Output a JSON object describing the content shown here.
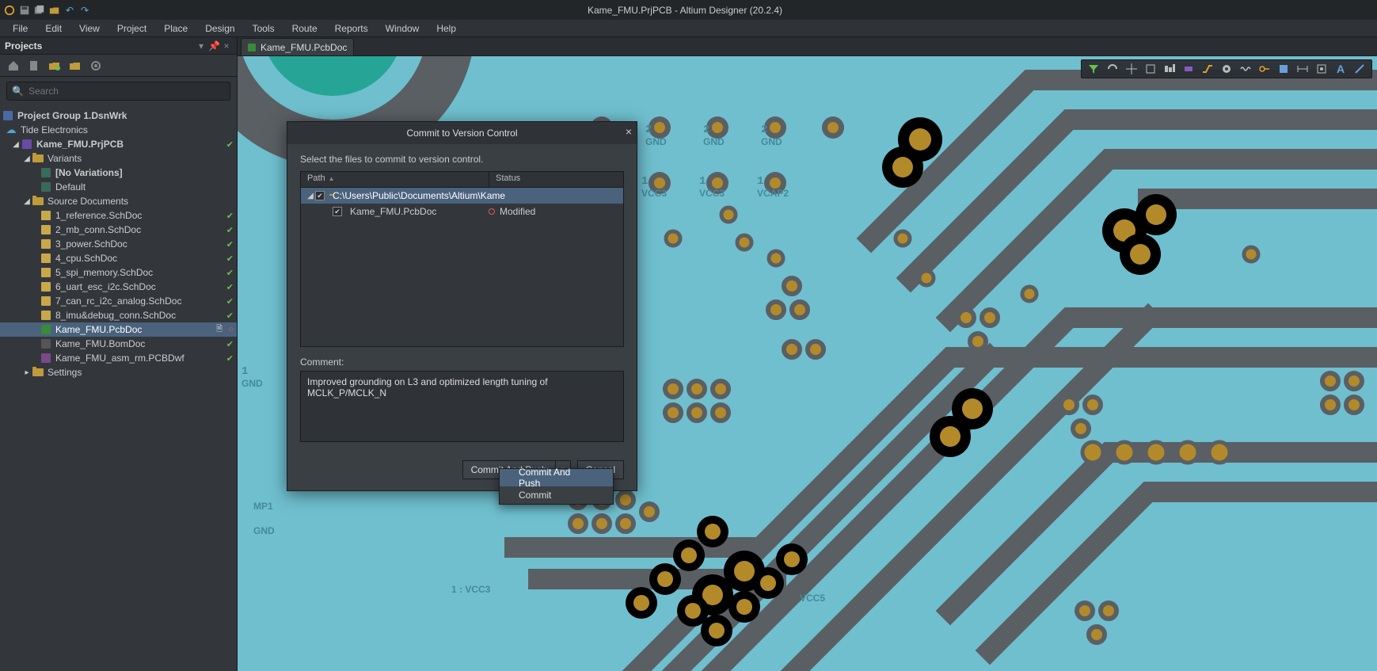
{
  "title": "Kame_FMU.PrjPCB - Altium Designer (20.2.4)",
  "menu": [
    "File",
    "Edit",
    "View",
    "Project",
    "Place",
    "Design",
    "Tools",
    "Route",
    "Reports",
    "Window",
    "Help"
  ],
  "panel": {
    "title": "Projects"
  },
  "search": {
    "placeholder": "Search"
  },
  "tree": {
    "group": "Project Group 1.DsnWrk",
    "workspace": "Tide Electronics",
    "project": "Kame_FMU.PrjPCB",
    "variants": "Variants",
    "novars": "[No Variations]",
    "default": "Default",
    "srcdocs": "Source Documents",
    "docs": [
      "1_reference.SchDoc",
      "2_mb_conn.SchDoc",
      "3_power.SchDoc",
      "4_cpu.SchDoc",
      "5_spi_memory.SchDoc",
      "6_uart_esc_i2c.SchDoc",
      "7_can_rc_i2c_analog.SchDoc",
      "8_imu&debug_conn.SchDoc",
      "Kame_FMU.PcbDoc",
      "Kame_FMU.BomDoc",
      "Kame_FMU_asm_rm.PCBDwf"
    ],
    "settings": "Settings"
  },
  "tab": {
    "name": "Kame_FMU.PcbDoc"
  },
  "dialog": {
    "title": "Commit to Version Control",
    "instr": "Select the files to commit to version control.",
    "hdr_path": "Path",
    "hdr_status": "Status",
    "folder": "C:\\Users\\Public\\Documents\\Altium\\Kame",
    "file": "Kame_FMU.PcbDoc",
    "file_status": "Modified",
    "comment_label": "Comment:",
    "comment": "Improved grounding on L3 and optimized length tuning of MCLK_P/MCLK_N",
    "btn_commit_push": "Commit And Push",
    "btn_cancel": "Cancel"
  },
  "dropdown": {
    "push": "Commit And Push",
    "commit": "Commit"
  },
  "pcblabels": {
    "gnd": "GND",
    "vcc3": "VCC3",
    "vcap2": "VCAP2",
    "mp1": "MP1",
    "gnd2": "GND",
    "vcc5": "VCC5",
    "vcc3b": "1 : VCC3"
  }
}
